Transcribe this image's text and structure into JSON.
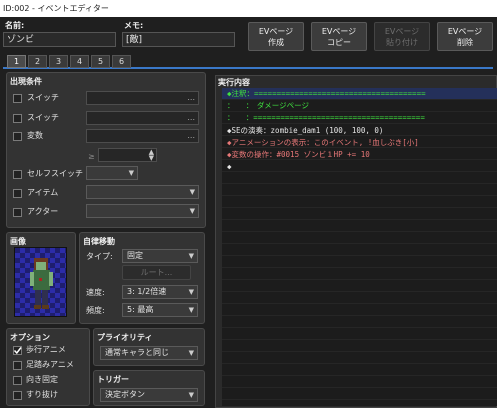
{
  "window": {
    "title": "ID:002 - イベントエディター"
  },
  "name_field": {
    "label": "名前:",
    "value": "ゾンビ"
  },
  "memo_field": {
    "label": "メモ:",
    "value": "[敵]"
  },
  "ev_buttons": {
    "create": [
      "EVページ",
      "作成"
    ],
    "copy": [
      "EVページ",
      "コピー"
    ],
    "paste": [
      "EVページ",
      "貼り付け"
    ],
    "delete": [
      "EVページ",
      "削除"
    ]
  },
  "page_tabs": [
    "1",
    "2",
    "3",
    "4",
    "5",
    "6"
  ],
  "conditions": {
    "title": "出現条件",
    "switch1": "スイッチ",
    "switch2": "スイッチ",
    "variable": "変数",
    "gte": "≥",
    "self_switch": "セルフスイッチ",
    "item": "アイテム",
    "actor": "アクター",
    "dots": "..."
  },
  "image": {
    "title": "画像"
  },
  "autonomous": {
    "title": "自律移動",
    "type_label": "タイプ:",
    "type_value": "固定",
    "route_button": "ルート...",
    "speed_label": "速度:",
    "speed_value": "3: 1/2倍速",
    "freq_label": "頻度:",
    "freq_value": "5: 最高"
  },
  "options": {
    "title": "オプション",
    "walking": "歩行アニメ",
    "walking_checked": true,
    "stepping": "足踏みアニメ",
    "fixed_dir": "向き固定",
    "through": "すり抜け"
  },
  "priority": {
    "title": "プライオリティ",
    "value": "通常キャラと同じ"
  },
  "trigger": {
    "title": "トリガー",
    "value": "決定ボタン"
  },
  "contents": {
    "title": "実行内容",
    "lines": [
      {
        "text": "◆注釈：======================================",
        "color": "#3fe23f"
      },
      {
        "text": "：　　：　ダメージページ",
        "color": "#3fe23f"
      },
      {
        "text": "：　　：======================================",
        "color": "#3fe23f"
      },
      {
        "text": "◆SEの演奏：zombie_dam1 (100, 100, 0)",
        "color": "#e6e6e6"
      },
      {
        "text": "◆アニメーションの表示：このイベント, !血しぶき[小]",
        "color": "#e87878"
      },
      {
        "text": "◆変数の操作：#0015 ゾンビ１HP += 10",
        "color": "#e87878"
      },
      {
        "text": "◆",
        "color": "#e6e6e6"
      }
    ]
  }
}
